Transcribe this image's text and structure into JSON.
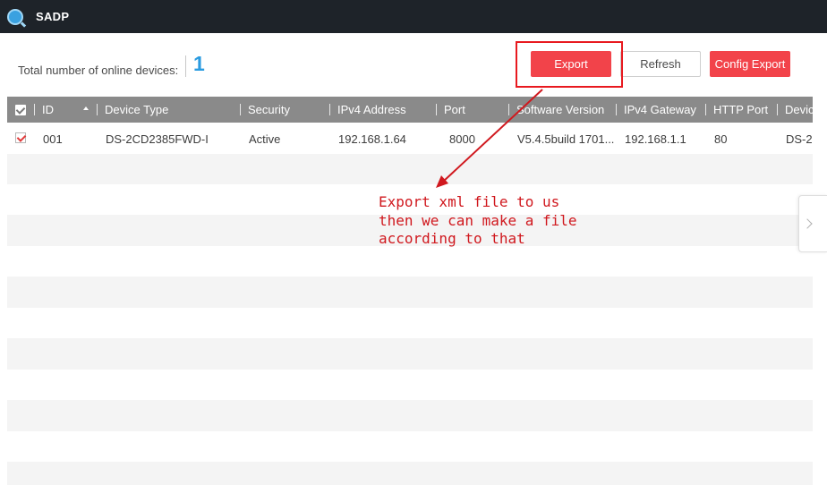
{
  "window": {
    "title": "SADP",
    "logo_icon": "sadp-logo-icon"
  },
  "summary": {
    "online_label": "Total number of online devices:",
    "online_count": "1"
  },
  "toolbar": {
    "export_label": "Export",
    "refresh_label": "Refresh",
    "config_export_label": "Config Export"
  },
  "table": {
    "columns": [
      "ID",
      "Device Type",
      "Security",
      "IPv4 Address",
      "Port",
      "Software Version",
      "IPv4 Gateway",
      "HTTP Port",
      "Devic"
    ],
    "sorted_column": "ID",
    "rows": [
      {
        "checked": true,
        "id": "001",
        "device_type": "DS-2CD2385FWD-I",
        "security": "Active",
        "ipv4_address": "192.168.1.64",
        "port": "8000",
        "software_version": "V5.4.5build 1701...",
        "ipv4_gateway": "192.168.1.1",
        "http_port": "80",
        "device_serial": "DS-2"
      }
    ]
  },
  "annotation": {
    "lines": [
      "Export xml file to us",
      "then we can make a file",
      "according to that"
    ]
  },
  "colors": {
    "titlebar": "#1e2329",
    "accent_red": "#f2434a",
    "count_blue": "#2a9be0",
    "table_header": "#8a8a8a",
    "annotation_red": "#d0181e"
  }
}
